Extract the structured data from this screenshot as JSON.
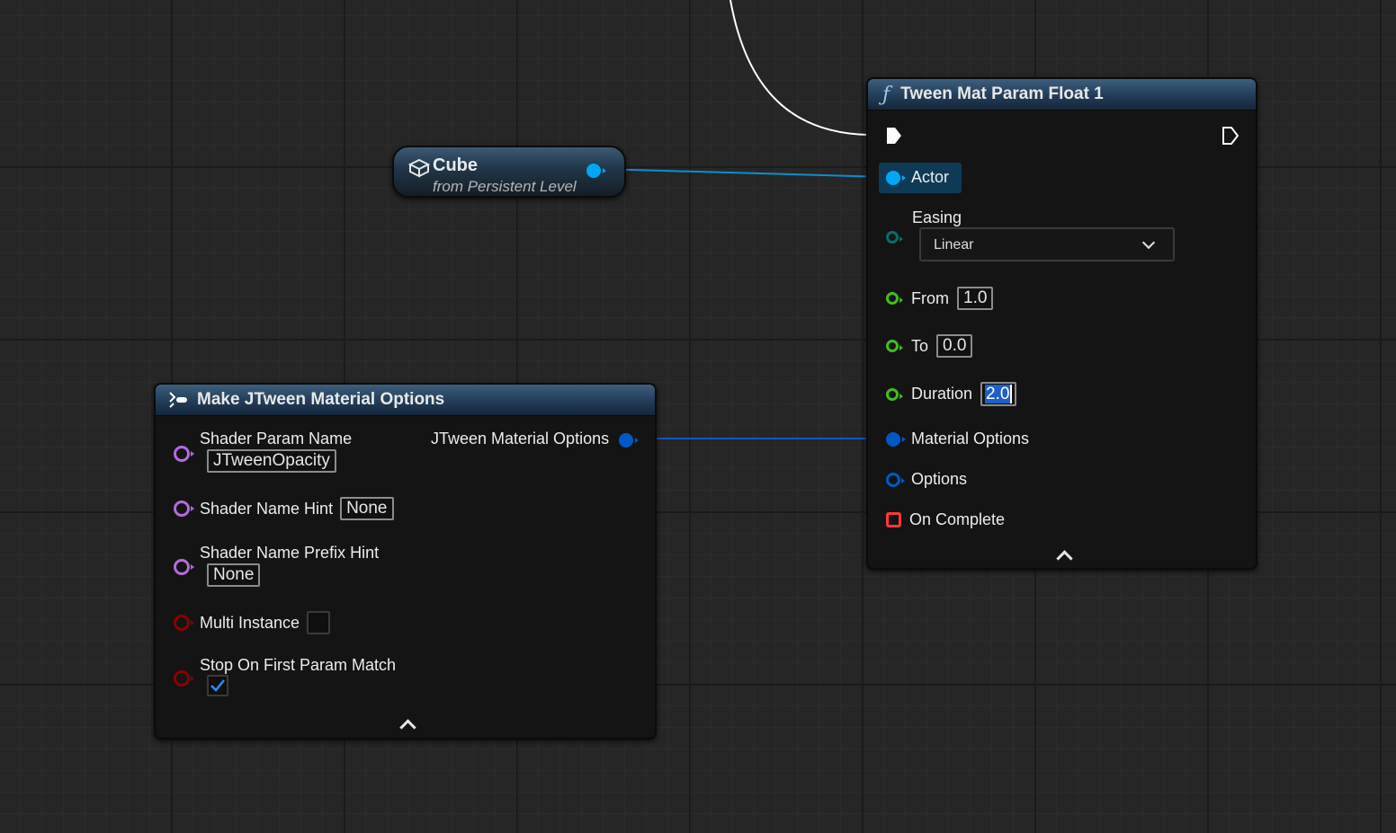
{
  "cube_node": {
    "title": "Cube",
    "subtitle": "from Persistent Level"
  },
  "tween_node": {
    "title": "Tween Mat Param Float 1",
    "function_icon": "ƒ",
    "actor_label": "Actor",
    "easing_label": "Easing",
    "easing_value": "Linear",
    "from_label": "From",
    "from_value": "1.0",
    "to_label": "To",
    "to_value": "0.0",
    "duration_label": "Duration",
    "duration_value": "2.0",
    "material_options_label": "Material Options",
    "options_label": "Options",
    "on_complete_label": "On Complete"
  },
  "make_node": {
    "title": "Make JTween Material Options",
    "shader_param_name_label": "Shader Param Name",
    "shader_param_name_value": "JTweenOpacity",
    "shader_name_hint_label": "Shader Name Hint",
    "shader_name_hint_value": "None",
    "shader_name_prefix_hint_label": "Shader Name Prefix Hint",
    "shader_name_prefix_hint_value": "None",
    "multi_instance_label": "Multi Instance",
    "multi_instance_checked": false,
    "stop_on_first_label": "Stop On First Param Match",
    "stop_on_first_checked": true,
    "output_label": "JTween Material Options"
  },
  "colors": {
    "object_pin": "#00a8f2",
    "struct_pin": "#0058c8",
    "float_pin": "#3fbf1f",
    "enum_pin": "#0a6b6b",
    "name_pin": "#b56ae0",
    "bool_pin": "#8c0000",
    "delegate_pin": "#ff3838",
    "exec_wire": "#ffffff",
    "object_wire": "#0a8fd0",
    "struct_wire": "#1456c4"
  }
}
